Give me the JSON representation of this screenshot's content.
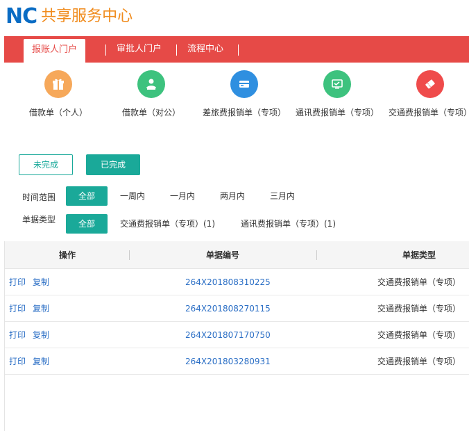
{
  "header": {
    "logo_mark": "NC",
    "title": "共享服务中心"
  },
  "nav": {
    "tabs": [
      {
        "label": "报账人门户"
      },
      {
        "label": "审批人门户"
      },
      {
        "label": "流程中心"
      }
    ]
  },
  "quick": [
    {
      "label": "借款单（个人）",
      "icon": "gift-icon",
      "color": "#f6a85a"
    },
    {
      "label": "借款单（对公）",
      "icon": "people-icon",
      "color": "#3dc27e"
    },
    {
      "label": "差旅费报销单（专项）",
      "icon": "card-icon",
      "color": "#2f8fe0"
    },
    {
      "label": "通讯费报销单（专项）",
      "icon": "monitor-icon",
      "color": "#3dc27e"
    },
    {
      "label": "交通费报销单（专项）",
      "icon": "ticket-icon",
      "color": "#ef4b4b"
    }
  ],
  "status": {
    "incomplete": "未完成",
    "complete": "已完成"
  },
  "filters": {
    "time_label": "时间范围",
    "time_options": [
      "全部",
      "一周内",
      "一月内",
      "两月内",
      "三月内"
    ],
    "type_label": "单据类型",
    "type_options": [
      "全部",
      "交通费报销单（专项）(1)",
      "通讯费报销单（专项）(1)"
    ]
  },
  "table": {
    "columns": [
      "操作",
      "单据编号",
      "单据类型"
    ],
    "print_label": "打印",
    "copy_label": "复制",
    "rows": [
      {
        "code": "264X201808310225",
        "type": "交通费报销单（专项）"
      },
      {
        "code": "264X201808270115",
        "type": "交通费报销单（专项）"
      },
      {
        "code": "264X201807170750",
        "type": "交通费报销单（专项）"
      },
      {
        "code": "264X201803280931",
        "type": "交通费报销单（专项）"
      }
    ]
  }
}
